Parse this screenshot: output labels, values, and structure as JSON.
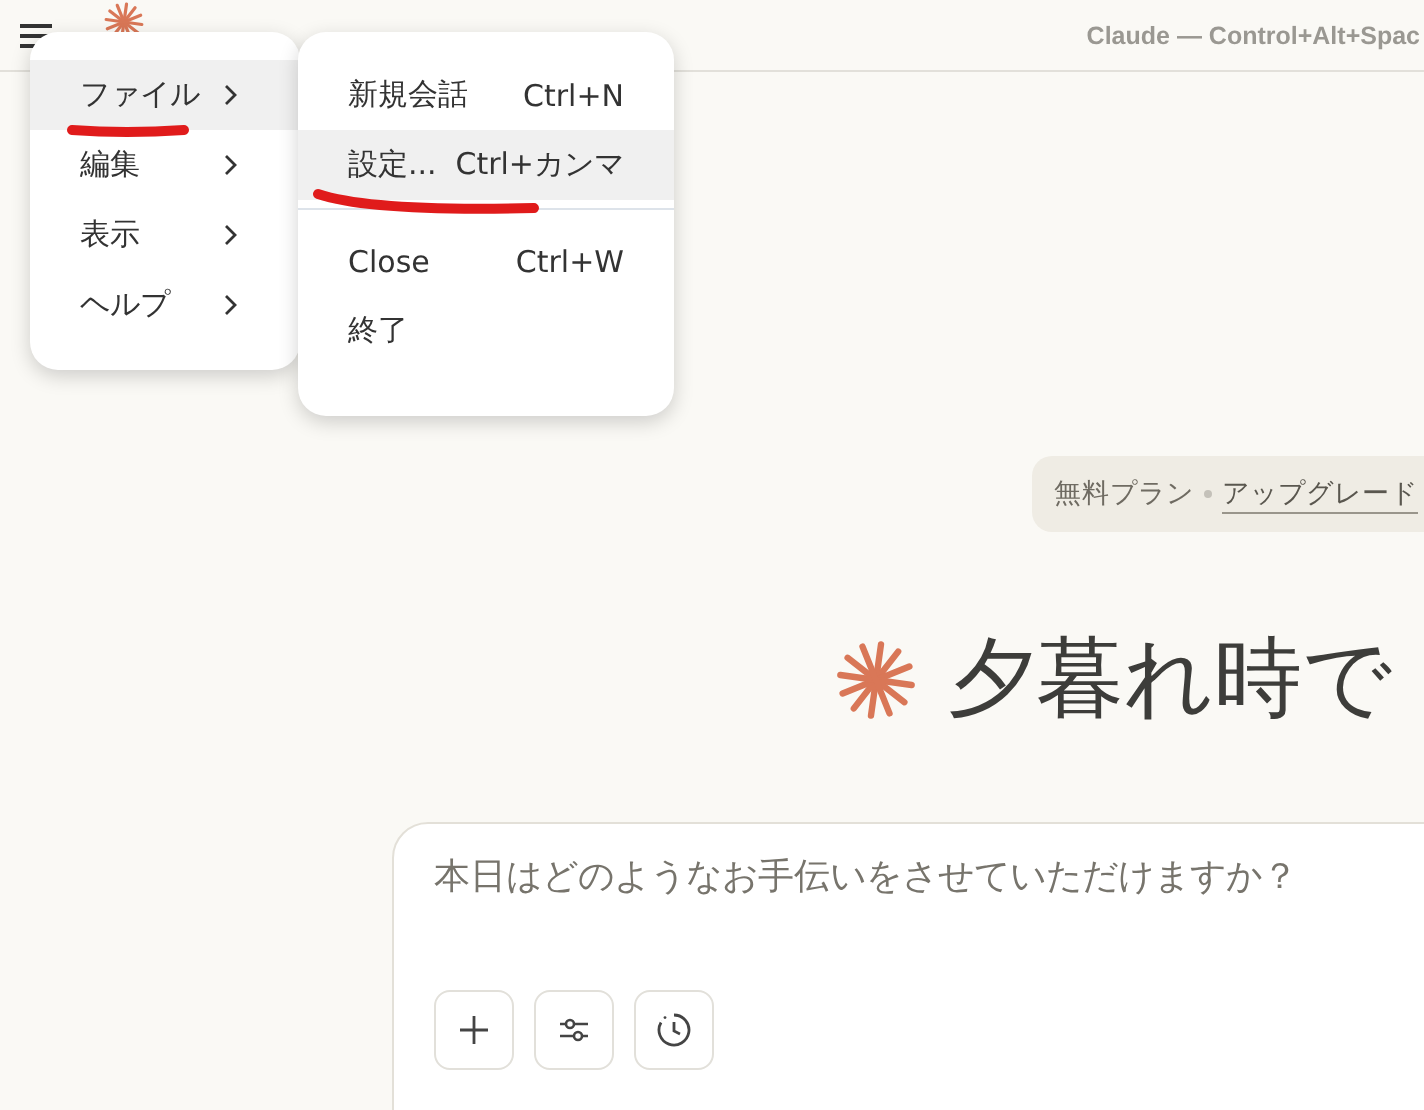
{
  "window": {
    "title": "Claude — Control+Alt+Spac"
  },
  "menu": {
    "items": [
      {
        "label": "ファイル",
        "selected": true,
        "marked": true
      },
      {
        "label": "編集",
        "selected": false,
        "marked": false
      },
      {
        "label": "表示",
        "selected": false,
        "marked": false
      },
      {
        "label": "ヘルプ",
        "selected": false,
        "marked": false
      }
    ]
  },
  "submenu": {
    "items": [
      {
        "kind": "item",
        "label": "新規会話",
        "shortcut": "Ctrl+N",
        "selected": false,
        "marked": false
      },
      {
        "kind": "item",
        "label": "設定...",
        "shortcut": "Ctrl+カンマ",
        "selected": true,
        "marked": true
      },
      {
        "kind": "separator"
      },
      {
        "kind": "item",
        "label": "Close",
        "shortcut": "Ctrl+W",
        "selected": false,
        "marked": false
      },
      {
        "kind": "item",
        "label": "終了",
        "selected": false,
        "marked": false
      }
    ]
  },
  "plan_badge": {
    "plan": "無料プラン",
    "link": "アップグレード"
  },
  "greeting": "夕暮れ時で",
  "composer": {
    "placeholder": "本日はどのようなお手伝いをさせていただけますか？"
  }
}
